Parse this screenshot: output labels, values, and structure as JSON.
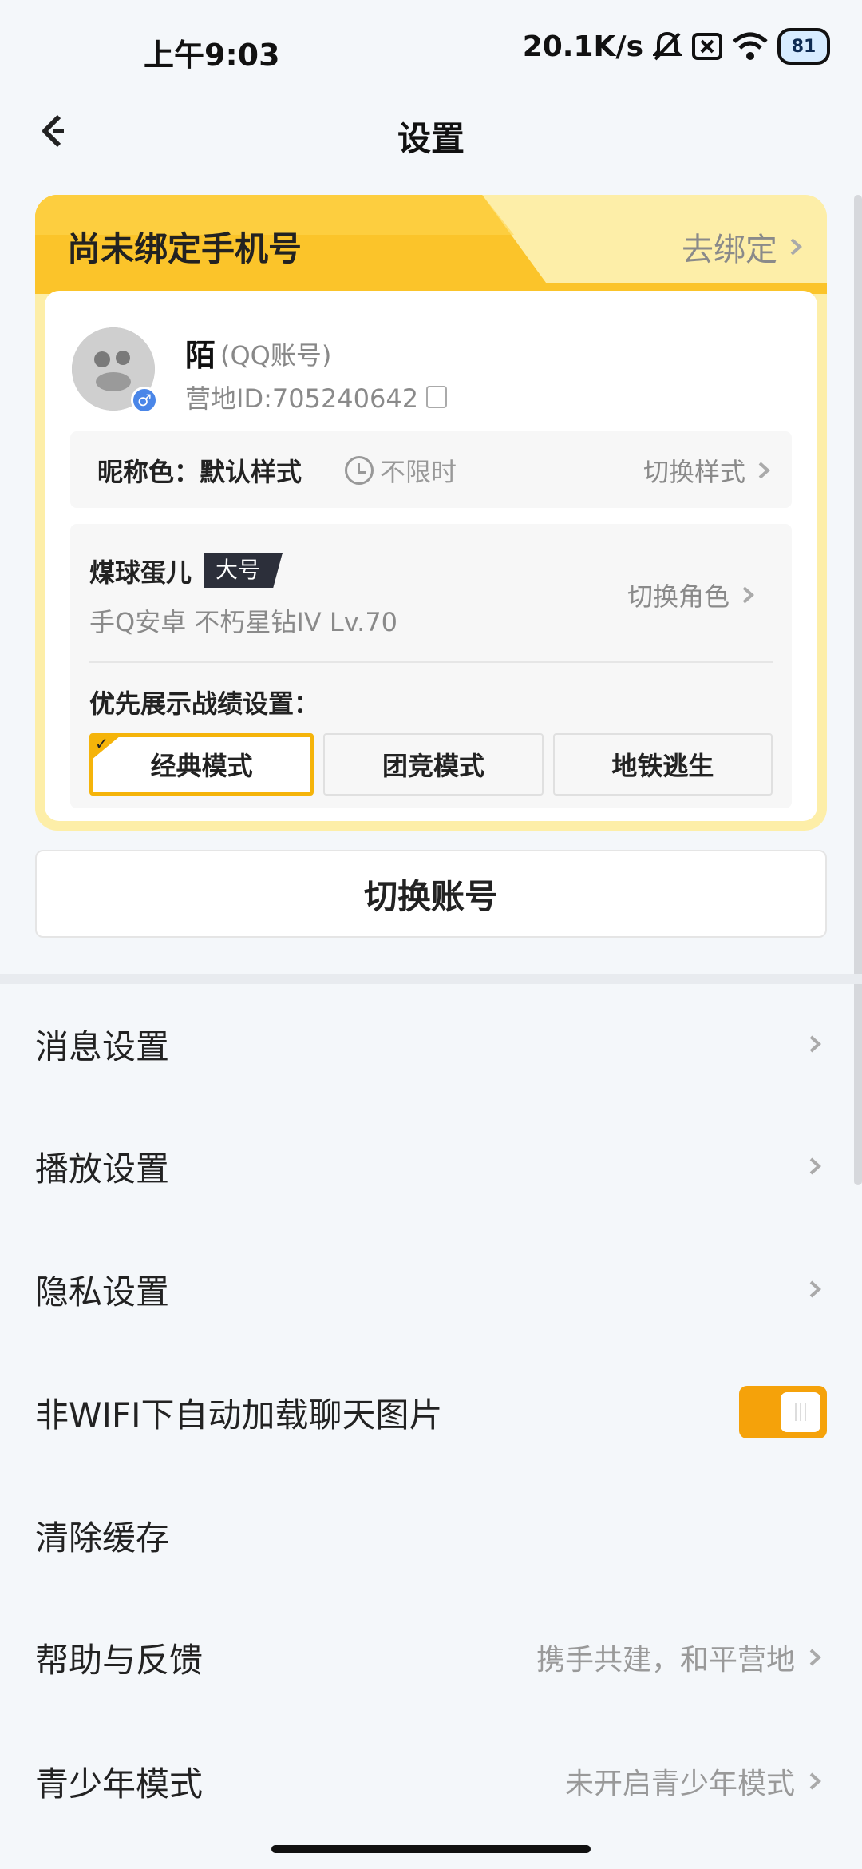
{
  "status": {
    "time": "上午9:03",
    "network_speed": "20.1K/s",
    "battery": "81"
  },
  "header": {
    "title": "设置"
  },
  "card": {
    "unbound_title": "尚未绑定手机号",
    "bind_link": "去绑定",
    "user_name": "陌",
    "account_type": "(QQ账号)",
    "camp_id": "营地ID:705240642",
    "nickname_color_label": "昵称色：默认样式",
    "nickname_time": "不限时",
    "switch_style": "切换样式",
    "role_name": "煤球蛋儿",
    "role_tag": "大号",
    "role_info": "手Q安卓   不朽星钻IV   Lv.70",
    "switch_role": "切换角色",
    "pref_label": "优先展示战绩设置：",
    "modes": [
      "经典模式",
      "团竞模式",
      "地铁逃生"
    ],
    "active_mode_index": 0
  },
  "switch_account": "切换账号",
  "menu": [
    {
      "label": "消息设置",
      "value": ""
    },
    {
      "label": "播放设置",
      "value": ""
    },
    {
      "label": "隐私设置",
      "value": ""
    },
    {
      "label": "非WIFI下自动加载聊天图片",
      "toggle": true
    },
    {
      "label": "清除缓存",
      "value": ""
    },
    {
      "label": "帮助与反馈",
      "value": "携手共建，和平营地"
    },
    {
      "label": "青少年模式",
      "value": "未开启青少年模式"
    }
  ],
  "colors": {
    "accent": "#f5b40a",
    "toggle_on": "#f5a20a",
    "background": "#f4f7fa"
  }
}
